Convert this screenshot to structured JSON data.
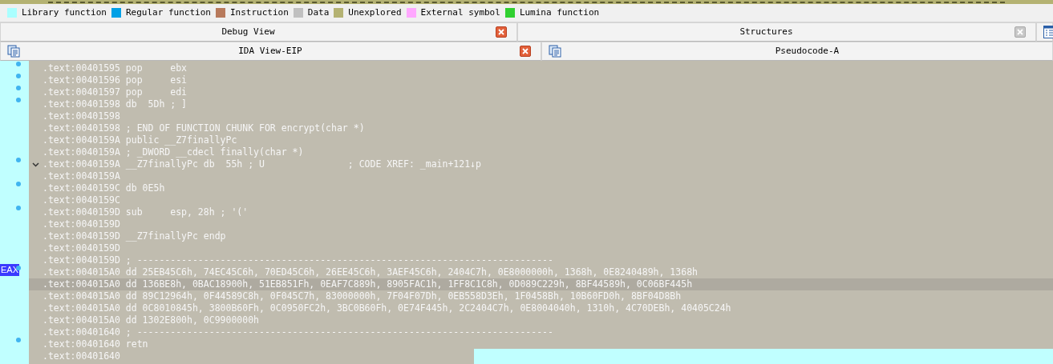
{
  "legend": [
    {
      "label": "Library function",
      "color": "#aaffff"
    },
    {
      "label": "Regular function",
      "color": "#00a0e6"
    },
    {
      "label": "Instruction",
      "color": "#b87a5c"
    },
    {
      "label": "Data",
      "color": "#c0c0c0"
    },
    {
      "label": "Unexplored",
      "color": "#b4b272"
    },
    {
      "label": "External symbol",
      "color": "#ffa8ff"
    },
    {
      "label": "Lumina function",
      "color": "#30d030"
    }
  ],
  "tab_rows": [
    [
      {
        "title": "Debug View",
        "kind": "plain",
        "closable": true,
        "close_disabled": false
      },
      {
        "title": "Structures",
        "kind": "structures",
        "closable": true,
        "close_disabled": true
      },
      {
        "kind": "list",
        "closable": false
      }
    ],
    [
      {
        "title": "IDA View-EIP",
        "kind": "view",
        "closable": true,
        "close_disabled": false
      },
      {
        "title": "Pseudocode-A",
        "kind": "view",
        "closable": false
      }
    ]
  ],
  "lines": [
    {
      "text": ".text:00401595 pop     ebx",
      "dot": true,
      "fold": false,
      "current": false
    },
    {
      "text": ".text:00401596 pop     esi",
      "dot": true,
      "fold": false,
      "current": false
    },
    {
      "text": ".text:00401597 pop     edi",
      "dot": true,
      "fold": false,
      "current": false
    },
    {
      "text": ".text:00401598 db  5Dh ; ]",
      "dot": true,
      "fold": false,
      "current": false
    },
    {
      "text": ".text:00401598",
      "dot": false,
      "fold": false,
      "current": false
    },
    {
      "text": ".text:00401598 ; END OF FUNCTION CHUNK FOR encrypt(char *)",
      "dot": false,
      "fold": false,
      "current": false
    },
    {
      "text": ".text:0040159A public __Z7finallyPc",
      "dot": false,
      "fold": false,
      "current": false
    },
    {
      "text": ".text:0040159A ; _DWORD __cdecl finally(char *)",
      "dot": false,
      "fold": false,
      "current": false
    },
    {
      "text": ".text:0040159A __Z7finallyPc db  55h ; U               ; CODE XREF: _main+121↓p",
      "dot": true,
      "fold": true,
      "current": false
    },
    {
      "text": ".text:0040159A",
      "dot": false,
      "fold": false,
      "current": false
    },
    {
      "text": ".text:0040159C db 0E5h",
      "dot": true,
      "fold": false,
      "current": false
    },
    {
      "text": ".text:0040159C",
      "dot": false,
      "fold": false,
      "current": false
    },
    {
      "text": ".text:0040159D sub     esp, 28h ; '('",
      "dot": true,
      "fold": false,
      "current": false
    },
    {
      "text": ".text:0040159D",
      "dot": false,
      "fold": false,
      "current": false
    },
    {
      "text": ".text:0040159D __Z7finallyPc endp",
      "dot": false,
      "fold": false,
      "current": false
    },
    {
      "text": ".text:0040159D",
      "dot": false,
      "fold": false,
      "current": false
    },
    {
      "text": ".text:0040159D ; ---------------------------------------------------------------------------",
      "dot": false,
      "fold": false,
      "current": false
    },
    {
      "text": ".text:004015A0 dd 25EB45C6h, 74EC45C6h, 70ED45C6h, 26EE45C6h, 3AEF45C6h, 2404C7h, 0E8000000h, 1368h, 0E8240489h, 1368h",
      "dot": true,
      "fold": false,
      "current": false,
      "register": "EAX"
    },
    {
      "text": ".text:004015A0 dd 136BE8h, 0BAC18900h, 51EB851Fh, 0EAF7C889h, 8905FAC1h, 1FF8C1C8h, 0D089C229h, 8BF44589h, 0C06BF445h",
      "dot": false,
      "fold": false,
      "current": true
    },
    {
      "text": ".text:004015A0 dd 89C12964h, 0F44589C8h, 0F045C7h, 83000000h, 7F04F07Dh, 0EB558D3Eh, 1F0458Bh, 10B60FD0h, 8BF04D8Bh",
      "dot": false,
      "fold": false,
      "current": false
    },
    {
      "text": ".text:004015A0 dd 0C8010845h, 3800B60Fh, 0C0950FC2h, 3BC0B60Fh, 0E74F445h, 2C2404C7h, 0E8004040h, 1310h, 4C70DEBh, 40405C24h",
      "dot": false,
      "fold": false,
      "current": false
    },
    {
      "text": ".text:004015A0 dd 1302E800h, 0C9900000h",
      "dot": false,
      "fold": false,
      "current": false
    },
    {
      "text": ".text:00401640 ; ---------------------------------------------------------------------------",
      "dot": false,
      "fold": false,
      "current": false
    },
    {
      "text": ".text:00401640 retn",
      "dot": true,
      "fold": false,
      "current": false
    },
    {
      "text": ".text:00401640",
      "dot": false,
      "fold": false,
      "current": false
    }
  ]
}
